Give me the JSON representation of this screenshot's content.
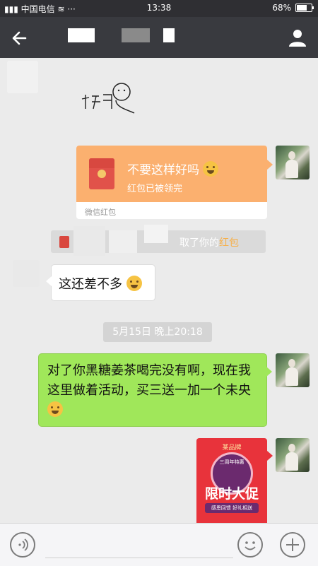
{
  "status_bar": {
    "carrier": "中国电信",
    "time": "13:38",
    "battery": "68%",
    "battery_level": 0.68
  },
  "nav": {
    "back_icon": "arrow-left-icon",
    "contact_icon": "person-icon"
  },
  "messages": {
    "red_packet": {
      "greeting": "不要这样好吗",
      "status": "红包已被领完",
      "footer": "微信红包"
    },
    "system_notice": {
      "text": "取了你的",
      "link": "红包"
    },
    "incoming_text": "这还差不多",
    "timestamp": "5月15日 晚上20:18",
    "outgoing_text": "对了你黑糖姜茶喝完没有啊，现在我这里做着活动，买三送一加一个未央",
    "promo": {
      "brand": "某品牌",
      "subtitle": "三周年特惠",
      "headline": "限时大促",
      "tag": "感恩回馈 好礼相送"
    }
  },
  "input_bar": {
    "voice_icon": "voice-icon",
    "emoji_icon": "emoji-icon",
    "plus_icon": "plus-icon"
  },
  "colors": {
    "nav_bg": "#393a3f",
    "chat_bg": "#ebebeb",
    "outgoing_bubble": "#a0e75a",
    "red_packet": "#fbb06f",
    "link": "#f7b04a"
  }
}
